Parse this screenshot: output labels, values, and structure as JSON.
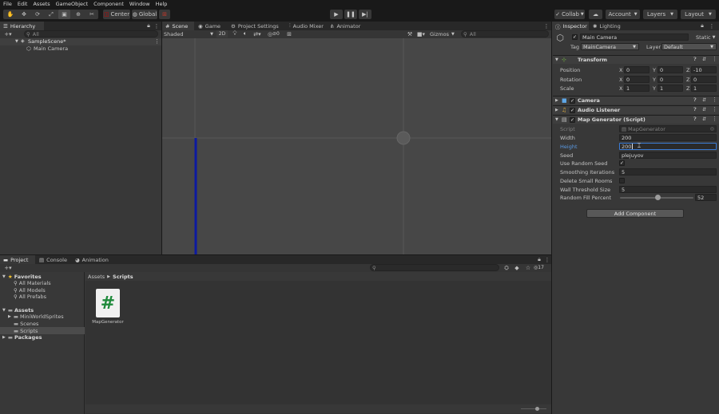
{
  "menu": [
    "File",
    "Edit",
    "Assets",
    "GameObject",
    "Component",
    "Window",
    "Help"
  ],
  "toolbar": {
    "pivot": "Center",
    "space": "Global",
    "collab": "Collab",
    "account": "Account",
    "layers": "Layers",
    "layout": "Layout"
  },
  "hierarchy": {
    "tab": "Hierarchy",
    "search_placeholder": "All",
    "scene": "SampleScene*",
    "objects": [
      "Main Camera"
    ]
  },
  "scene_tabs": [
    "Scene",
    "Game",
    "Project Settings",
    "Audio Mixer",
    "Animator"
  ],
  "scene_toolbar": {
    "shading": "Shaded",
    "mode_2d": "2D",
    "fx_count": "0",
    "gizmos": "Gizmos",
    "search_placeholder": "All"
  },
  "inspector": {
    "tabs": [
      "Inspector",
      "Lighting"
    ],
    "object_name": "Main Camera",
    "static_label": "Static",
    "tag_label": "Tag",
    "tag_value": "MainCamera",
    "layer_label": "Layer",
    "layer_value": "Default",
    "transform": {
      "title": "Transform",
      "position_label": "Position",
      "rotation_label": "Rotation",
      "scale_label": "Scale",
      "axis_x": "X",
      "axis_y": "Y",
      "axis_z": "Z",
      "position": [
        "0",
        "0",
        "-10"
      ],
      "rotation": [
        "0",
        "0",
        "0"
      ],
      "scale": [
        "1",
        "1",
        "1"
      ]
    },
    "camera_title": "Camera",
    "audio_title": "Audio Listener",
    "script_comp": {
      "title": "Map Generator (Script)",
      "script_label": "Script",
      "script_value": "MapGenerator",
      "width_label": "Width",
      "width_value": "200",
      "height_label": "Height",
      "height_value": "200",
      "seed_label": "Seed",
      "seed_value": "plejuyov",
      "use_random_label": "Use Random Seed",
      "use_random_checked": true,
      "smoothing_label": "Smoothing Iterations",
      "smoothing_value": "5",
      "delete_small_label": "Delete Small Rooms",
      "delete_small_checked": false,
      "wall_threshold_label": "Wall Threshold Size",
      "wall_threshold_value": "5",
      "fill_label": "Random Fill Percent",
      "fill_value": "52",
      "fill_fraction": 0.52
    },
    "add_component": "Add Component"
  },
  "bottom_tabs": [
    "Project",
    "Console",
    "Animation"
  ],
  "project": {
    "badge": "17",
    "favorites_label": "Favorites",
    "favorites": [
      "All Materials",
      "All Models",
      "All Prefabs"
    ],
    "assets_label": "Assets",
    "asset_folders": [
      "MiniWorldSprites",
      "Scenes",
      "Scripts"
    ],
    "packages_label": "Packages",
    "breadcrumb": [
      "Assets",
      "Scripts"
    ],
    "files": [
      {
        "name": "MapGenerator",
        "glyph": "#"
      }
    ]
  },
  "colors": {
    "accent_blue": "#2b5b9e",
    "scene_bg": "#474747",
    "selection_line": "#0c1aa0",
    "script_icon_green": "#1f8a3b"
  }
}
